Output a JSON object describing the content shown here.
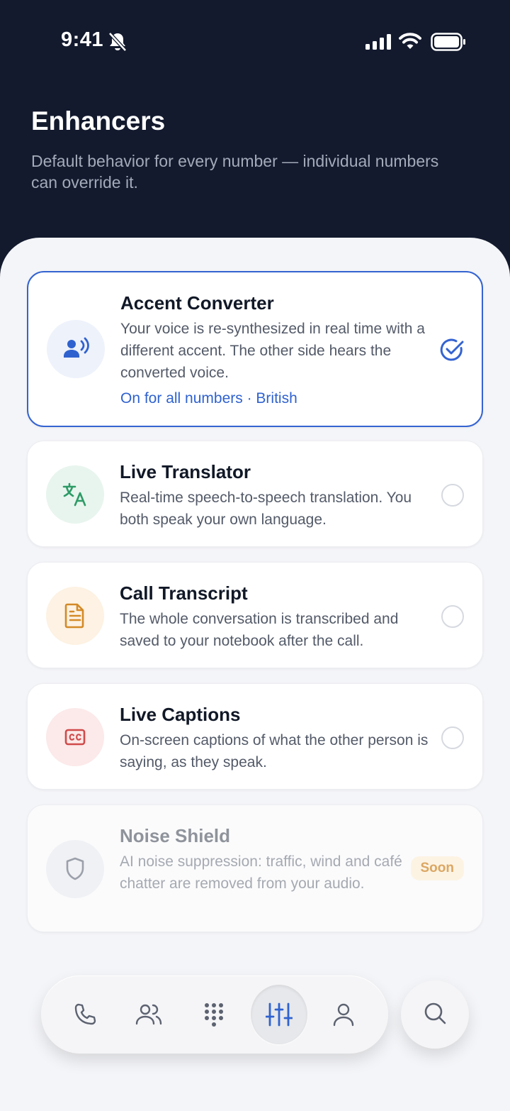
{
  "status_bar": {
    "time": "9:41"
  },
  "header": {
    "title": "Enhancers",
    "subtitle": "Default behavior for every number — individual numbers can override it."
  },
  "cards": [
    {
      "title": "Accent Converter",
      "description": "Your voice is re-synthesized in real time with a different accent. The other side hears the converted voice.",
      "status": "On for all numbers · British",
      "icon": "voice-speaking-icon",
      "selected": true
    },
    {
      "title": "Live Translator",
      "description": "Real-time speech-to-speech translation. You both speak your own language.",
      "icon": "translate-icon",
      "selected": false
    },
    {
      "title": "Call Transcript",
      "description": "The whole conversation is transcribed and saved to your notebook after the call.",
      "icon": "document-icon",
      "selected": false
    },
    {
      "title": "Live Captions",
      "description": "On-screen captions of what the other person is saying, as they speak.",
      "icon": "closed-captions-icon",
      "selected": false
    },
    {
      "title": "Noise Shield",
      "description": "AI noise suppression: traffic, wind and café chatter are removed from your audio.",
      "badge": "Soon",
      "icon": "shield-icon",
      "disabled": true
    }
  ],
  "nav": {
    "items": [
      "phone-icon",
      "contacts-icon",
      "keypad-icon",
      "sliders-icon",
      "profile-icon"
    ],
    "active": "sliders-icon",
    "search": "search-icon"
  },
  "colors": {
    "header_bg": "#131A2E",
    "accent": "#3463D1",
    "sheet_bg": "#F4F5F8"
  }
}
